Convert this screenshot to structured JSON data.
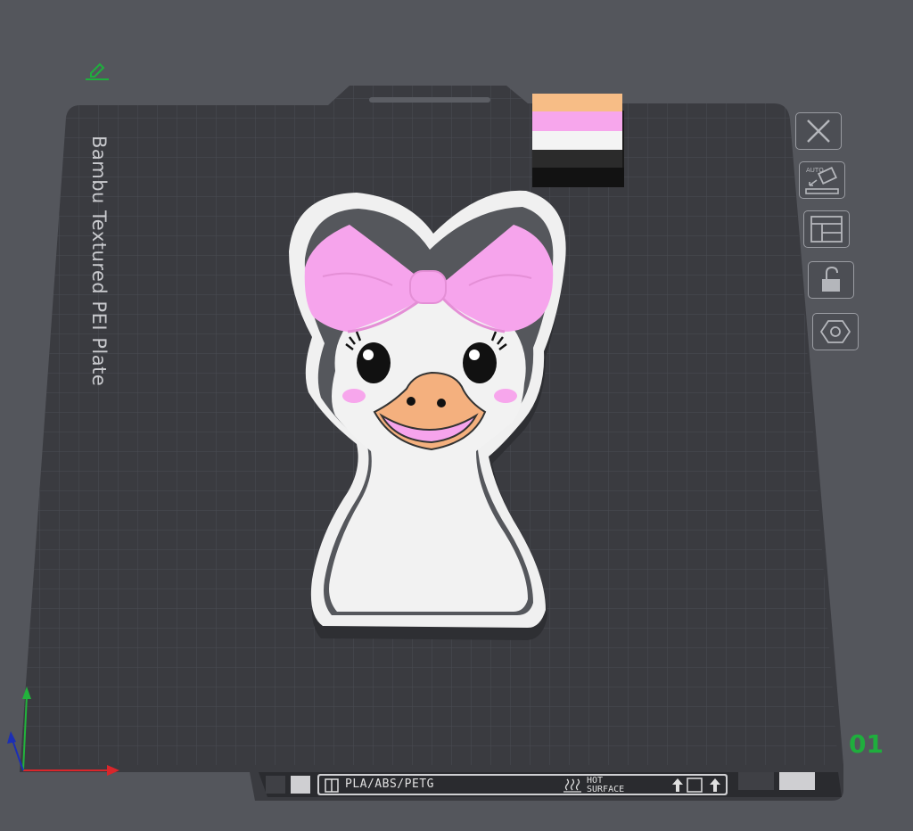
{
  "plate": {
    "label": "Bambu Textured PEI Plate",
    "number": "01",
    "filament_types": "PLA/ABS/PETG",
    "surface_line1": "HOT",
    "surface_line2": "SURFACE"
  },
  "toolbar": {
    "buttons": [
      {
        "icon": "close-icon"
      },
      {
        "icon": "auto-orient-icon",
        "label": "AUTO"
      },
      {
        "icon": "arrange-icon"
      },
      {
        "icon": "lock-icon"
      },
      {
        "icon": "plate-settings-icon"
      }
    ]
  },
  "purge_tower": {
    "colors": [
      "#f7bd86",
      "#f7a6ec",
      "#f4f4f4",
      "#1a1a1a"
    ]
  },
  "model": {
    "name": "duck-with-bow",
    "colors": {
      "base": "#f2f2f2",
      "bow": "#f6a4ec",
      "beak": "#f4b07e",
      "eye": "#111111",
      "cheek": "#f7a6ec"
    }
  },
  "colors": {
    "background": "#54565c",
    "plate": "#3a3b40",
    "grid": "#4c4e54",
    "plate_number": "#1fae3d",
    "axis_x": "#d9262b",
    "axis_y": "#22b33c",
    "axis_z": "#1c2fb5"
  }
}
